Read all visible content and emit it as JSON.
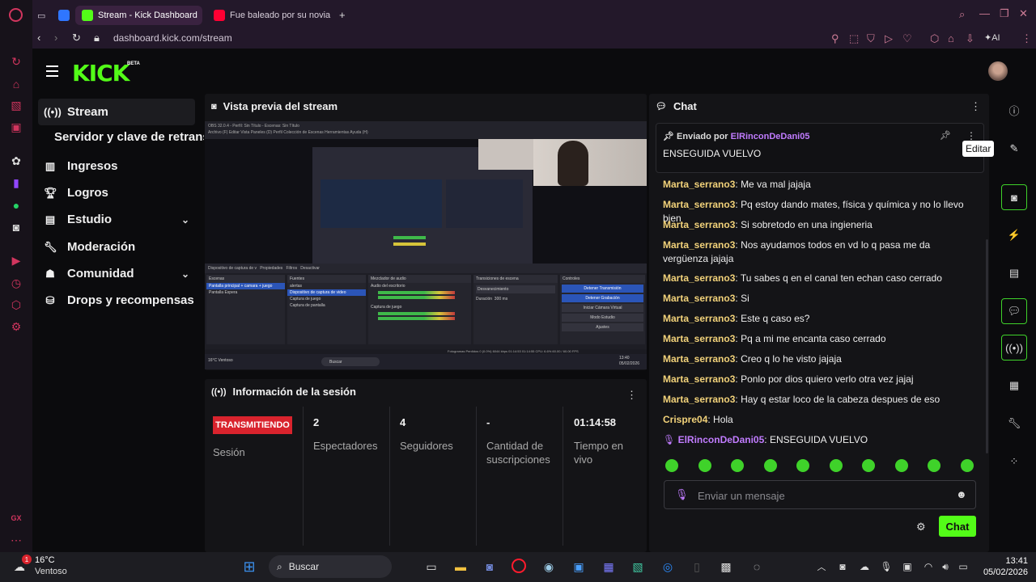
{
  "browser": {
    "tabs": [
      {
        "label": "Stream - Kick Dashboard",
        "active": true
      },
      {
        "label": "Fue baleado por su novia c",
        "active": false
      }
    ],
    "url_host": "dashboard.kick.com",
    "url_path": "/stream",
    "ai_label": "AI",
    "rail_label": "GX"
  },
  "kick": {
    "logo": "KICK",
    "beta": "BETA"
  },
  "sidebar": {
    "items": [
      {
        "label": "Stream",
        "icon": "broadcast-icon"
      },
      {
        "label": "Ingresos",
        "icon": "chart-icon"
      },
      {
        "label": "Logros",
        "icon": "trophy-icon"
      },
      {
        "label": "Estudio",
        "icon": "studio-icon"
      },
      {
        "label": "Moderación",
        "icon": "wrench-icon"
      },
      {
        "label": "Comunidad",
        "icon": "community-icon"
      },
      {
        "label": "Drops y recompensas",
        "icon": "drops-icon"
      }
    ],
    "sub_item": "Servidor y clave de retransmisión"
  },
  "preview": {
    "title": "Vista previa del stream",
    "obs": {
      "menu": "Archivo (F)  Editar  Vista  Paneles (D)  Perfil  Colección de Escenas  Herramientas  Ayuda (H)",
      "window_title": "OBS 32.0.4 - Perfil: Sin Título - Escenas: Sin Título",
      "source_bar": "Dispositivo de captura de v",
      "props": "Propiedades",
      "filters": "Filtros",
      "deactivate": "Desactivar",
      "scenes_title": "Escenas",
      "scenes": [
        "Pantalla principal + camara + juego",
        "Pantalla Espera"
      ],
      "sources_title": "Fuentes",
      "sources": [
        "alertas",
        "Dispositivo de captura de video",
        "Captura de juego",
        "Captura de pantalla"
      ],
      "mixer_title": "Mezclador de audio",
      "mixer": [
        "Audio del escritorio",
        "Captura de juego"
      ],
      "transitions_title": "Transiciones de escena",
      "transition": "Desvanecimiento",
      "duration_label": "Duración",
      "duration": "300 ms",
      "controls_title": "Controles",
      "controls": [
        "Detener Transmisión",
        "Detener Grabación",
        "Iniciar Cámara Virtual",
        "Modo Estudio",
        "Ajustes"
      ],
      "status_bar": "Fotogramas Perdidos 0 (0.0%)   6044 kbps   01:14:53   01:14:55   CPU: 6.6%   60.00 / 60.00 FPS",
      "taskbar_search": "Buscar",
      "weather": "16°C Ventoso",
      "time": "13:40",
      "date": "05/02/2026"
    }
  },
  "session": {
    "title": "Información de la sesión",
    "status": "TRANSMITIENDO",
    "status_label": "Sesión",
    "stats": [
      {
        "value": "2",
        "label": "Espectadores"
      },
      {
        "value": "4",
        "label": "Seguidores"
      },
      {
        "value": "-",
        "label": "Cantidad de suscripciones"
      },
      {
        "value": "01:14:58",
        "label": "Tiempo en vivo"
      }
    ]
  },
  "chat": {
    "title": "Chat",
    "pinned": {
      "sent_by": "Enviado por",
      "user": "ElRinconDeDani05",
      "message": "ENSEGUIDA VUELVO"
    },
    "messages": [
      {
        "user": "Marta_serrano3",
        "text": "Me va mal jajaja"
      },
      {
        "user": "Marta_serrano3",
        "text": "Pq estoy dando mates, física y química y no lo llevo bien"
      },
      {
        "user": "Marta_serrano3",
        "text": "Si sobretodo en una ingieneria"
      },
      {
        "user": "Marta_serrano3",
        "text": "Nos ayudamos todos en vd lo q pasa me da vergüenza jajaja"
      },
      {
        "user": "Marta_serrano3",
        "text": "Tu sabes q en el canal ten echan caso cerrado"
      },
      {
        "user": "Marta_serrano3",
        "text": "Si"
      },
      {
        "user": "Marta_serrano3",
        "text": "Este q caso es?"
      },
      {
        "user": "Marta_serrano3",
        "text": "Pq a mi me encanta caso cerrado"
      },
      {
        "user": "Marta_serrano3",
        "text": "Creo q lo he visto jajaja"
      },
      {
        "user": "Marta_serrano3",
        "text": "Ponlo por dios quiero verlo otra vez jajaj"
      },
      {
        "user": "Marta_serrano3",
        "text": "Hay q estar loco de la cabeza despues de eso"
      },
      {
        "user": "Crispre04",
        "text": "Hola"
      },
      {
        "user": "ElRinconDeDani05",
        "text": "ENSEGUIDA VUELVO"
      }
    ],
    "input_placeholder": "Enviar un mensaje",
    "send_label": "Chat",
    "emote_count": 10
  },
  "dock": {
    "tooltip": "Editar"
  },
  "taskbar": {
    "temp": "16°C",
    "weather": "Ventoso",
    "search": "Buscar",
    "time": "13:41",
    "date": "05/02/2026",
    "notification_count": "1"
  }
}
